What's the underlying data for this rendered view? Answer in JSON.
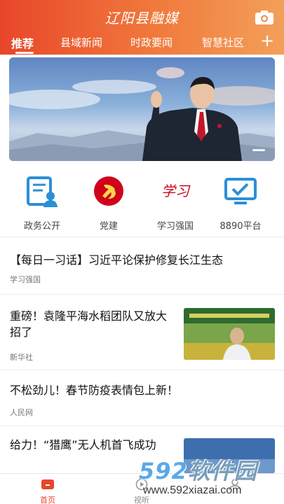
{
  "header": {
    "app_title": "辽阳县融媒",
    "tabs": [
      {
        "label": "推荐",
        "active": true
      },
      {
        "label": "县域新闻"
      },
      {
        "label": "时政要闻"
      },
      {
        "label": "智慧社区"
      }
    ],
    "camera_icon": "camera-icon",
    "add_tab_icon": "plus-icon",
    "accent": "#e8462a"
  },
  "banner": {
    "icon": "banner-image"
  },
  "quick_links": [
    {
      "label": "政务公开",
      "icon": "government-affairs-icon",
      "color": "#2b8fd6"
    },
    {
      "label": "党建",
      "icon": "party-emblem-icon",
      "color": "#d0021b"
    },
    {
      "label": "学习强国",
      "icon": "xuexi-logo-icon",
      "color": "#d0021b"
    },
    {
      "label": "8890平台",
      "icon": "monitor-check-icon",
      "color": "#2b8fd6"
    }
  ],
  "news": [
    {
      "title": "【每日一习话】习近平论保护修复长江生态",
      "source": "学习强国"
    },
    {
      "title": "重磅！袁隆平海水稻团队又放大招了",
      "source": "新华社"
    },
    {
      "title": "不松劲儿！春节防疫表情包上新！",
      "source": "人民网"
    },
    {
      "title": "给力！“猎鹰”无人机首飞成功",
      "source": ""
    }
  ],
  "bottom_nav": [
    {
      "label": "首页",
      "icon": "home-icon",
      "active": true
    },
    {
      "label": "视听",
      "icon": "play-icon"
    },
    {
      "label": "",
      "icon": "user-icon"
    }
  ],
  "watermark": {
    "brand_num": "592",
    "brand_cn": "软件园",
    "url": "www.592xiazai.com"
  }
}
